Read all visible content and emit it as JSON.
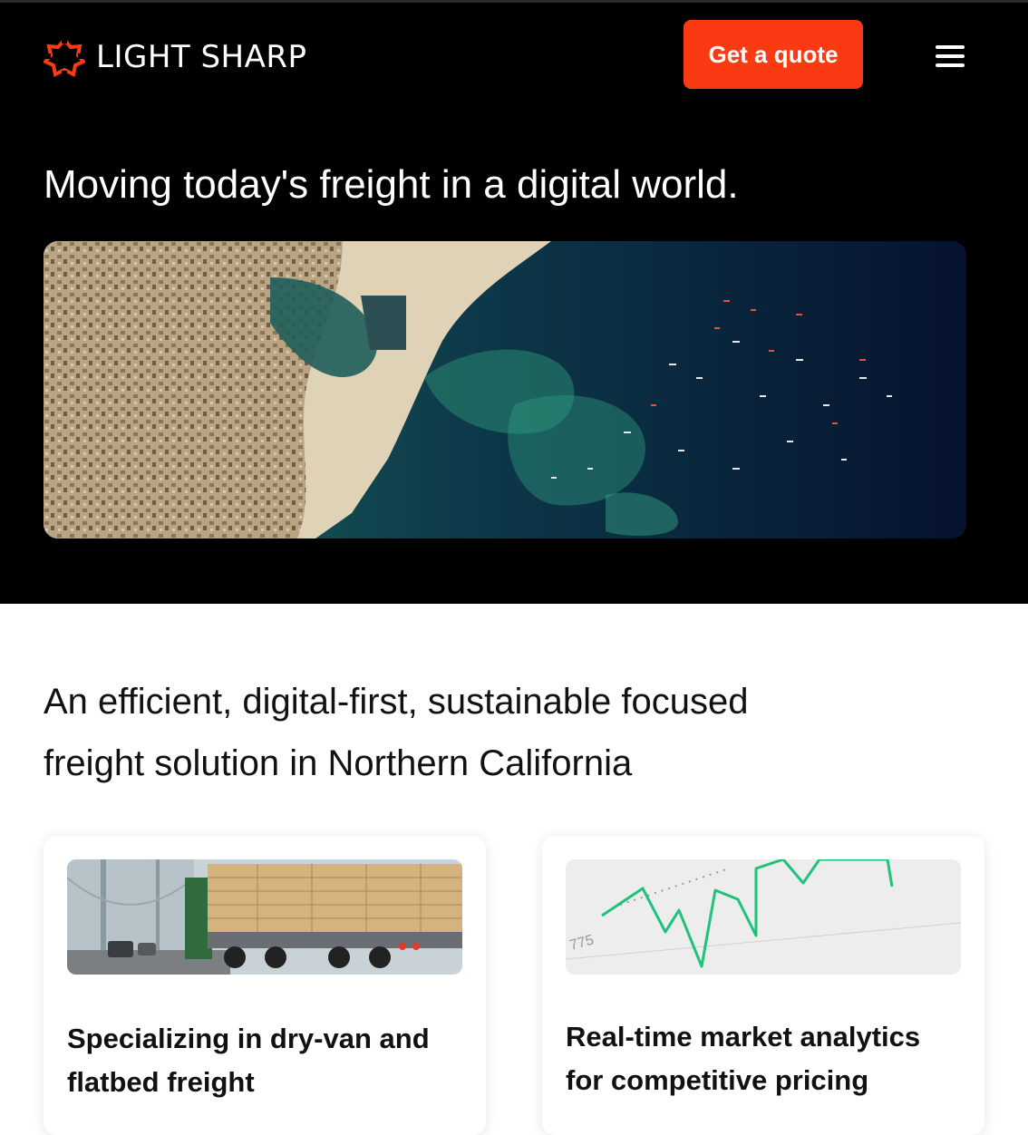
{
  "header": {
    "brand": "LIGHT SHARP",
    "logo_icon": "light-sharp-logo-icon",
    "cta_label": "Get a quote",
    "menu_icon": "hamburger-menu-icon"
  },
  "hero": {
    "title": "Moving today's freight in a digital world.",
    "image_alt": "Aerial satellite view of a port city and cargo ships at sea"
  },
  "intro": {
    "line1": "An efficient, digital-first, sustainable focused",
    "line2": "freight solution in Northern California"
  },
  "cards": [
    {
      "title_line1": "Specializing in dry-van and",
      "title_line2": "flatbed freight",
      "image_alt": "Flatbed truck carrying lumber on a bridge"
    },
    {
      "title_line1": "Real-time market analytics",
      "title_line2": "for competitive pricing",
      "image_alt": "Green market line chart",
      "chart_tick_label": "775"
    }
  ],
  "colors": {
    "accent": "#fa3a12",
    "hero_bg": "#000000",
    "page_bg": "#ffffff",
    "chart_line": "#1fc27a"
  }
}
